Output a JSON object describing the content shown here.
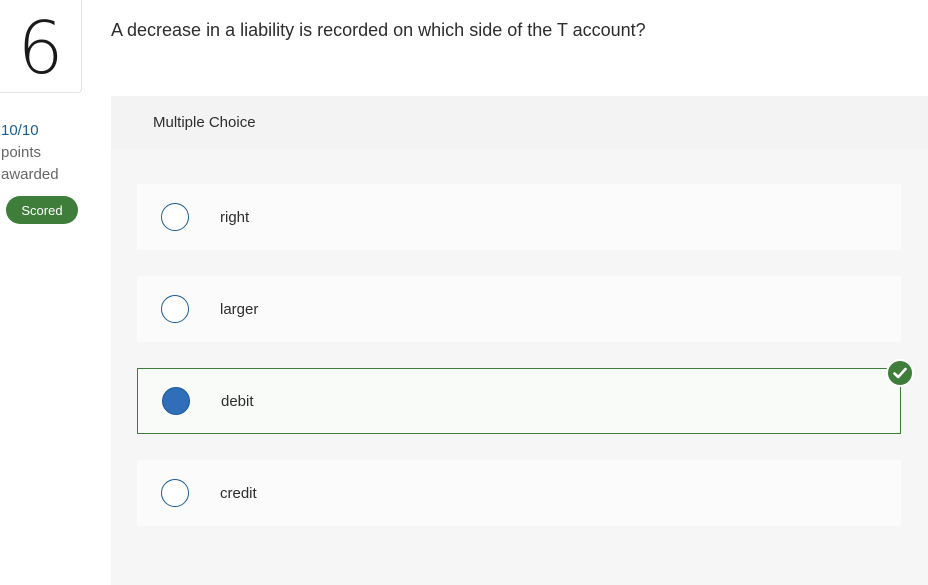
{
  "question": {
    "number": "6",
    "text": "A decrease in a liability is recorded on which side of the T account?",
    "score": "10/10",
    "points_label": "points",
    "awarded_label": "awarded",
    "status_badge": "Scored"
  },
  "answer_panel": {
    "type_label": "Multiple Choice",
    "options": [
      {
        "label": "right",
        "selected": false
      },
      {
        "label": "larger",
        "selected": false
      },
      {
        "label": "debit",
        "selected": true,
        "correct": true
      },
      {
        "label": "credit",
        "selected": false
      }
    ]
  },
  "colors": {
    "accent_blue": "#1b5e96",
    "selected_fill": "#2f6fba",
    "correct_green": "#3f7d3b"
  }
}
